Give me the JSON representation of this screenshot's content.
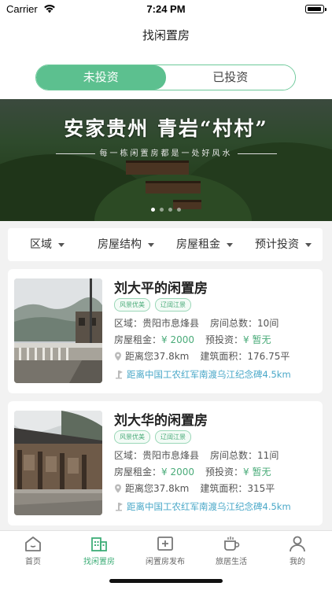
{
  "status": {
    "carrier": "Carrier",
    "time": "7:24 PM"
  },
  "nav": {
    "title": "找闲置房"
  },
  "segments": {
    "active": "未投资",
    "inactive": "已投资"
  },
  "banner": {
    "headline": "安家贵州  青岩“村村”",
    "subline": "每一栋闲置房都是一处好风水",
    "page_count": 4,
    "current_page": 1
  },
  "filters": [
    "区域",
    "房屋结构",
    "房屋租金",
    "预计投资"
  ],
  "listings": [
    {
      "title": "刘大平的闲置房",
      "tags": [
        "风景优美",
        "辽阔江景"
      ],
      "area_label": "区域：",
      "area": "贵阳市息烽县",
      "rooms_label": "房间总数：",
      "rooms": "10间",
      "rent_label": "房屋租金：",
      "rent": "¥ 2000",
      "invest_label": "预投资：",
      "invest": "¥ 暂无",
      "distance": "距离您37.8km",
      "building_label": "建筑面积：",
      "building": "176.75平",
      "landmark": "距离中国工农红军南渡乌江纪念碑4.5km"
    },
    {
      "title": "刘大华的闲置房",
      "tags": [
        "风景优美",
        "辽阔江景"
      ],
      "area_label": "区域：",
      "area": "贵阳市息烽县",
      "rooms_label": "房间总数：",
      "rooms": "11间",
      "rent_label": "房屋租金：",
      "rent": "¥ 2000",
      "invest_label": "预投资：",
      "invest": "¥ 暂无",
      "distance": "距离您37.8km",
      "building_label": "建筑面积：",
      "building": "315平",
      "landmark": "距离中国工农红军南渡乌江纪念碑4.5km"
    }
  ],
  "tabs": [
    "首页",
    "找闲置房",
    "闲置房发布",
    "旅居生活",
    "我的"
  ],
  "active_tab": "找闲置房",
  "colors": {
    "accent": "#5cc08f",
    "link": "#4aa8c8"
  }
}
